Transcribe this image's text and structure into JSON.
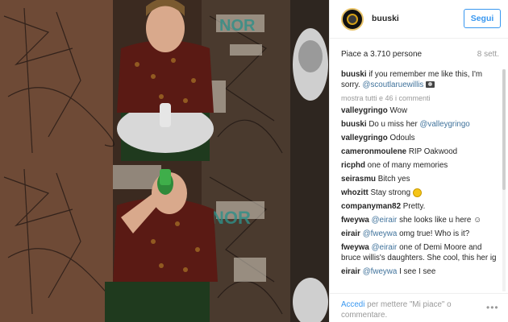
{
  "post": {
    "username": "buuski",
    "follow_label": "Segui",
    "likes": "Piace a 3.710 persone",
    "time": "8 sett.",
    "caption": {
      "user": "buuski",
      "text": "if you remember me like this, I'm sorry.",
      "mention": "@scoutlaruewillis"
    },
    "show_all": "mostra tutti e 46 i commenti",
    "comments": [
      {
        "user": "valleygringo",
        "mention": "",
        "text": "Wow"
      },
      {
        "user": "buuski",
        "mention": "",
        "text": "Do u miss her",
        "mention_after": "@valleygringo"
      },
      {
        "user": "valleygringo",
        "mention": "",
        "text": "Odouls"
      },
      {
        "user": "cameronmoulene",
        "mention": "",
        "text": "RIP Oakwood"
      },
      {
        "user": "ricphd",
        "mention": "",
        "text": "one of many memories"
      },
      {
        "user": "seirasmu",
        "mention": "",
        "text": "Bitch yes"
      },
      {
        "user": "whozitt",
        "mention": "",
        "text": "Stay strong"
      },
      {
        "user": "companyman82",
        "mention": "",
        "text": "Pretty."
      },
      {
        "user": "fweywa",
        "mention": "@eirair",
        "text": "she looks like u here"
      },
      {
        "user": "eirair",
        "mention": "@fweywa",
        "text": "omg true! Who is it?"
      },
      {
        "user": "fweywa",
        "mention": "@eirair",
        "text": "one of Demi Moore and bruce willis's daughters. She cool, this her ig"
      },
      {
        "user": "eirair",
        "mention": "@fweywa",
        "text": "I see I see"
      }
    ],
    "footer": {
      "login_link": "Accedi",
      "login_text": "per mettere \"Mi piace\" o commentare.",
      "more_icon": "more-options-icon"
    }
  },
  "colors": {
    "accent": "#3897f0",
    "mention": "#3f729b",
    "muted": "#999999"
  }
}
